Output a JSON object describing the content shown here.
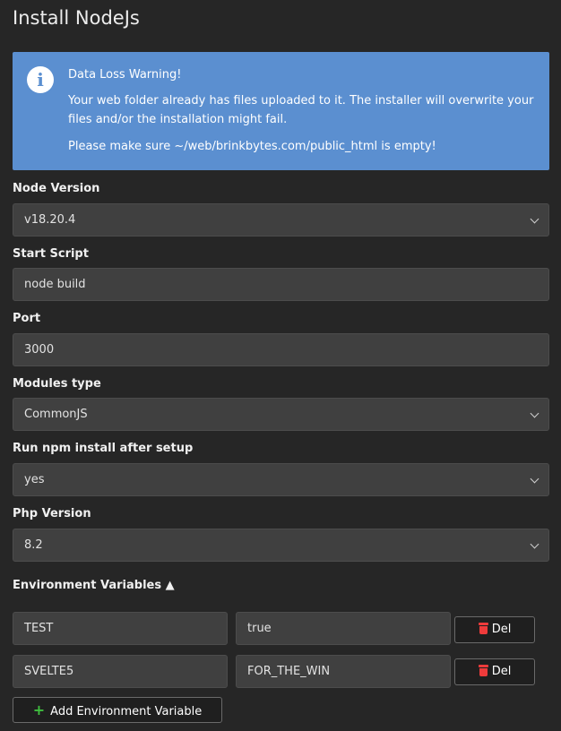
{
  "page": {
    "title": "Install NodeJs"
  },
  "alert": {
    "icon": "info-icon",
    "heading": "Data Loss Warning!",
    "message": "Your web folder already has files uploaded to it. The installer will overwrite your files and/or the installation might fail.",
    "instruction": "Please make sure ~/web/brinkbytes.com/public_html is empty!",
    "background_color": "#5b8fd0"
  },
  "form": {
    "node_version": {
      "label": "Node Version",
      "value": "v18.20.4"
    },
    "start_script": {
      "label": "Start Script",
      "value": "node build"
    },
    "port": {
      "label": "Port",
      "value": "3000"
    },
    "modules_type": {
      "label": "Modules type",
      "value": "CommonJS"
    },
    "run_npm_install": {
      "label": "Run npm install after setup",
      "value": "yes"
    },
    "php_version": {
      "label": "Php Version",
      "value": "8.2"
    }
  },
  "env": {
    "label": "Environment Variables ▲",
    "rows": [
      {
        "key": "TEST",
        "value": "true",
        "delete_label": "Del"
      },
      {
        "key": "SVELTE5",
        "value": "FOR_THE_WIN",
        "delete_label": "Del"
      }
    ],
    "add_label": "Add Environment Variable",
    "delete_icon": "trash-icon",
    "add_icon": "plus-icon",
    "delete_icon_color": "#ee3b3b",
    "add_icon_color": "#3fbf3f"
  }
}
